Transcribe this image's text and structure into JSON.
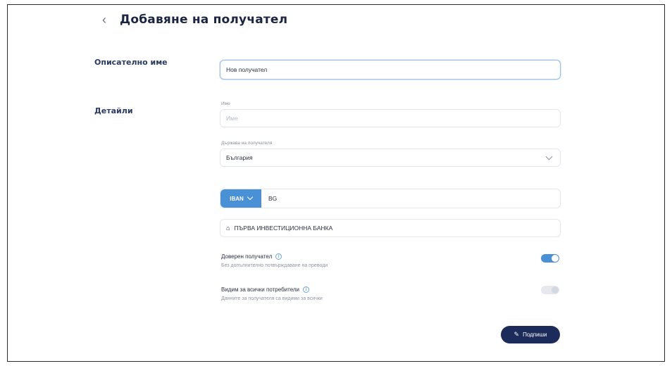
{
  "header": {
    "back_icon": "chevron-left-icon",
    "back_glyph": "‹",
    "title": "Добавяне на получател"
  },
  "description": {
    "section_label": "Описателно име",
    "input_value": "Нов получател"
  },
  "details": {
    "section_label": "Детайли",
    "name_label": "Име",
    "name_placeholder": "Име",
    "country_label": "Държава на получателя",
    "country_value": "България",
    "iban_type": "IBAN",
    "iban_value": "BG",
    "bank_icon": "bank-icon",
    "bank_glyph": "⌂",
    "bank_name": "ПЪРВА ИНВЕСТИЦИОННА БАНКА"
  },
  "trusted": {
    "title": "Доверен получател",
    "subtitle": "Без допълнително потвърждаване на преводи",
    "enabled": true
  },
  "visible_all": {
    "title": "Видим за всички потребители",
    "subtitle": "Данните за получателя са видими за всички",
    "enabled": false
  },
  "actions": {
    "sign_label": "Подпиши",
    "sign_icon": "pen-icon",
    "sign_glyph": "✎"
  },
  "colors": {
    "accent": "#4a90d6",
    "primary_button": "#1c2b59"
  }
}
